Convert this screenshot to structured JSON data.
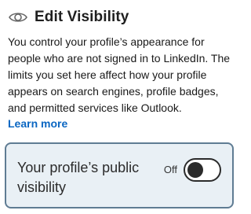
{
  "header": {
    "icon": "eye-icon",
    "title": "Edit Visibility"
  },
  "description": "You control your profile’s appearance for people who are not signed in to LinkedIn. The limits you set here affect how your profile appears on search engines, profile badges, and permitted services like Outlook.",
  "learn_more_label": "Learn more",
  "visibility_toggle": {
    "label": "Your profile’s public visibility",
    "state_label": "Off",
    "is_on": false
  },
  "colors": {
    "link": "#0a66c2",
    "card_background": "#e9f0f5",
    "card_border": "#5f7c93"
  }
}
